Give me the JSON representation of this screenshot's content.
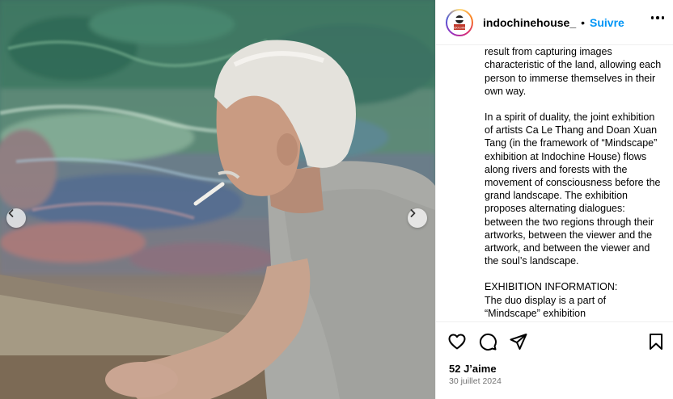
{
  "post": {
    "username": "indochinehouse_",
    "separator": "•",
    "follow_label": "Suivre",
    "avatar_text": "INDOCHINE HOUSE",
    "more_icon": "more-horizontal-icon",
    "caption_paragraphs": [
      "and semi-abstract styles, their creations result from capturing images characteristic of the land, allowing each person to immerse themselves in their own way.",
      "In a spirit of duality, the joint exhibition of artists Ca Le Thang and Doan Xuan Tang (in the framework of “Mindscape” exhibition at Indochine House) flows along rivers and forests with the movement of consciousness before the grand landscape. The exhibition proposes alternating dialogues: between the two regions through their artworks, between the viewer and the artwork, and between the viewer and the soul’s landscape.",
      "EXHIBITION INFORMATION:\nThe duo display is a part of “Mindscape” exhibition"
    ],
    "likes": "52 J’aime",
    "date": "30 juillet 2024"
  },
  "media": {
    "prev_icon": "chevron-left-icon",
    "next_icon": "chevron-right-icon"
  },
  "actions": {
    "like_icon": "heart-icon",
    "comment_icon": "comment-icon",
    "share_icon": "send-icon",
    "save_icon": "bookmark-icon"
  },
  "colors": {
    "accent": "#0095f6",
    "muted": "#737373",
    "border": "#efefef"
  }
}
